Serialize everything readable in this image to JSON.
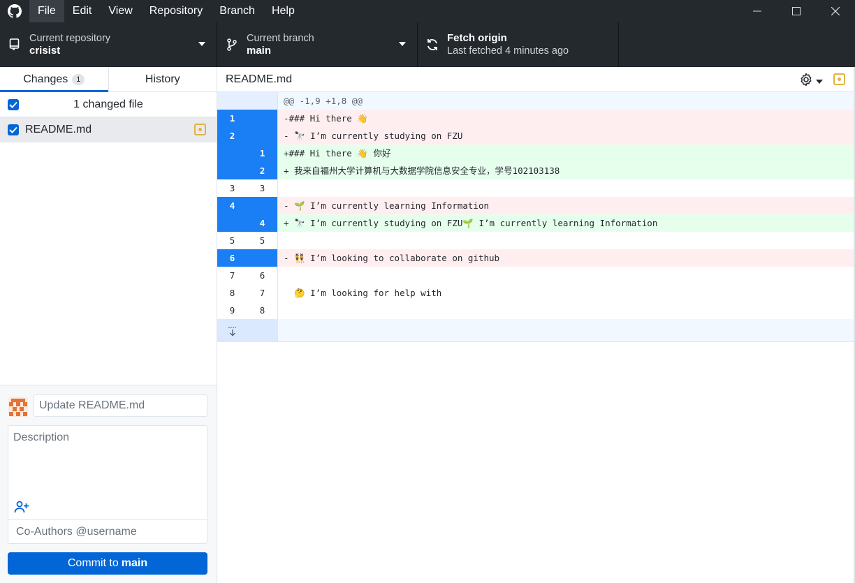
{
  "menu": {
    "items": [
      "File",
      "Edit",
      "View",
      "Repository",
      "Branch",
      "Help"
    ]
  },
  "toolbar": {
    "repo_label": "Current repository",
    "repo_value": "crisist",
    "branch_label": "Current branch",
    "branch_value": "main",
    "fetch_label": "Fetch origin",
    "fetch_status": "Last fetched 4 minutes ago"
  },
  "sidebar": {
    "tabs": [
      {
        "label": "Changes",
        "count": "1"
      },
      {
        "label": "History"
      }
    ],
    "changed_summary": "1 changed file",
    "files": [
      {
        "name": "README.md"
      }
    ]
  },
  "commit": {
    "summary_placeholder": "Update README.md",
    "description_placeholder": "Description",
    "coauthors_placeholder": "Co-Authors @username",
    "button_prefix": "Commit to",
    "button_branch": "main"
  },
  "diff": {
    "file_name": "README.md",
    "hunk_header": "@@ -1,9 +1,8 @@",
    "lines": [
      {
        "type": "del",
        "old": "1",
        "new": "",
        "text": "-### Hi there 👋"
      },
      {
        "type": "del",
        "old": "2",
        "new": "",
        "text": "- 🔭 I’m currently studying on FZU"
      },
      {
        "type": "add",
        "old": "",
        "new": "1",
        "text": "+### Hi there 👋 你好"
      },
      {
        "type": "add",
        "old": "",
        "new": "2",
        "text": "+ 我来自福州大学计算机与大数据学院信息安全专业，学号102103138"
      },
      {
        "type": "ctx",
        "old": "3",
        "new": "3",
        "text": ""
      },
      {
        "type": "del",
        "old": "4",
        "new": "",
        "text": "- 🌱 I’m currently learning Information"
      },
      {
        "type": "add",
        "old": "",
        "new": "4",
        "text": "+ 🔭 I’m currently studying on FZU🌱 I’m currently learning Information"
      },
      {
        "type": "ctx",
        "old": "5",
        "new": "5",
        "text": ""
      },
      {
        "type": "del",
        "old": "6",
        "new": "",
        "text": "- 👯 I’m looking to collaborate on github"
      },
      {
        "type": "ctx",
        "old": "7",
        "new": "6",
        "text": ""
      },
      {
        "type": "ctx",
        "old": "8",
        "new": "7",
        "text": "  🤔 I’m looking for help with"
      },
      {
        "type": "ctx",
        "old": "9",
        "new": "8",
        "text": ""
      }
    ]
  },
  "colors": {
    "accent": "#0366d6",
    "selected_gutter": "#1a7ef5",
    "deleted_bg": "#ffeef0",
    "added_bg": "#e6ffed",
    "modified": "#e3b341"
  },
  "icons": [
    "github-logo-icon",
    "minimize-icon",
    "maximize-icon",
    "close-icon",
    "repo-icon",
    "branch-icon",
    "sync-icon",
    "gear-icon",
    "add-coauthor-icon",
    "expand-down-icon"
  ]
}
